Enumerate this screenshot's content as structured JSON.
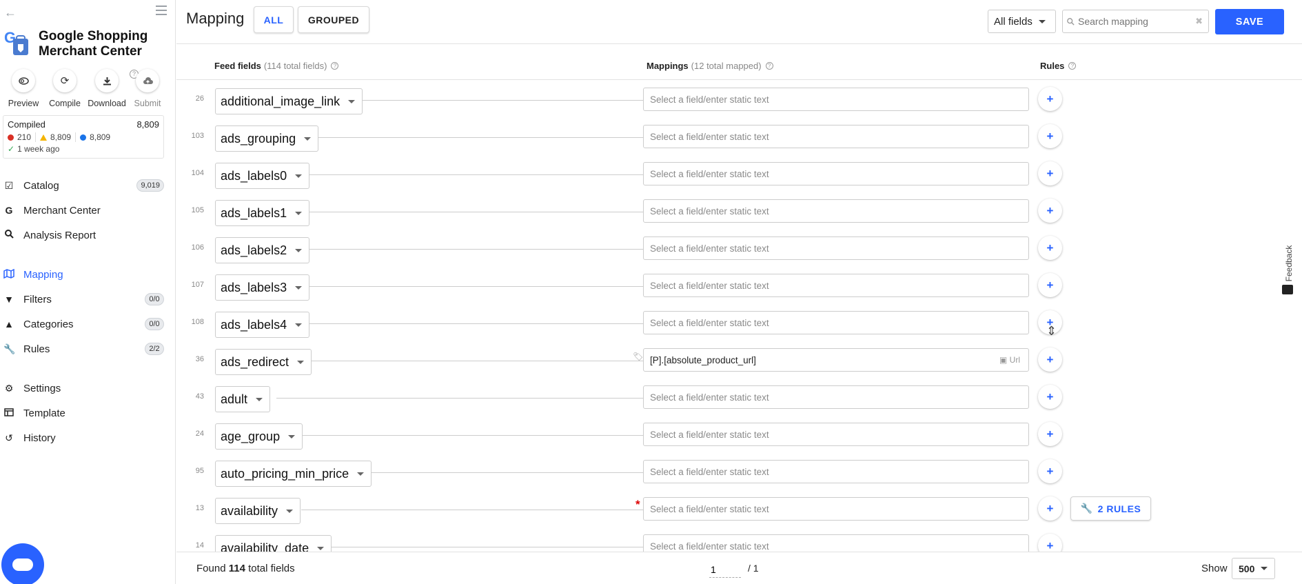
{
  "sidebar": {
    "brand_title": "Google Shopping Merchant Center",
    "actions": [
      {
        "label": "Preview",
        "icon": "eye-icon"
      },
      {
        "label": "Compile",
        "icon": "refresh-icon"
      },
      {
        "label": "Download",
        "icon": "download-icon"
      },
      {
        "label": "Submit",
        "icon": "cloud-upload-icon"
      }
    ],
    "compiled": {
      "title": "Compiled",
      "count": "8,809",
      "errors": "210",
      "warnings": "8,809",
      "info": "8,809",
      "time": "1 week ago"
    },
    "nav": [
      {
        "label": "Catalog",
        "badge": "9,019",
        "icon": "checkbox-icon"
      },
      {
        "label": "Merchant Center",
        "badge": "",
        "icon": "google-icon"
      },
      {
        "label": "Analysis Report",
        "badge": "",
        "icon": "search-icon"
      },
      {
        "label": "Mapping",
        "badge": "",
        "icon": "map-icon"
      },
      {
        "label": "Filters",
        "badge": "0/0",
        "icon": "filter-icon"
      },
      {
        "label": "Categories",
        "badge": "0/0",
        "icon": "tree-icon"
      },
      {
        "label": "Rules",
        "badge": "2/2",
        "icon": "wrench-icon"
      },
      {
        "label": "Settings",
        "badge": "",
        "icon": "gears-icon"
      },
      {
        "label": "Template",
        "badge": "",
        "icon": "table-icon"
      },
      {
        "label": "History",
        "badge": "",
        "icon": "history-icon"
      }
    ]
  },
  "header": {
    "title": "Mapping",
    "tab_all": "ALL",
    "tab_grouped": "GROUPED",
    "filter_label": "All fields",
    "search_placeholder": "Search mapping",
    "save_label": "SAVE"
  },
  "columns": {
    "feed_fields": "Feed fields",
    "feed_fields_sub": "(114 total fields)",
    "mappings": "Mappings",
    "mappings_sub": "(12 total mapped)",
    "rules": "Rules"
  },
  "rows": [
    {
      "num": "26",
      "field": "additional_image_link",
      "mapping": "",
      "placeholder": "Select a field/enter static text"
    },
    {
      "num": "103",
      "field": "ads_grouping",
      "mapping": "",
      "placeholder": "Select a field/enter static text"
    },
    {
      "num": "104",
      "field": "ads_labels0",
      "mapping": "",
      "placeholder": "Select a field/enter static text"
    },
    {
      "num": "105",
      "field": "ads_labels1",
      "mapping": "",
      "placeholder": "Select a field/enter static text"
    },
    {
      "num": "106",
      "field": "ads_labels2",
      "mapping": "",
      "placeholder": "Select a field/enter static text"
    },
    {
      "num": "107",
      "field": "ads_labels3",
      "mapping": "",
      "placeholder": "Select a field/enter static text"
    },
    {
      "num": "108",
      "field": "ads_labels4",
      "mapping": "",
      "placeholder": "Select a field/enter static text"
    },
    {
      "num": "36",
      "field": "ads_redirect",
      "mapping": "[P].[absolute_product_url]",
      "type": "Url",
      "placeholder": ""
    },
    {
      "num": "43",
      "field": "adult",
      "mapping": "",
      "placeholder": "Select a field/enter static text"
    },
    {
      "num": "24",
      "field": "age_group",
      "mapping": "",
      "placeholder": "Select a field/enter static text"
    },
    {
      "num": "95",
      "field": "auto_pricing_min_price",
      "mapping": "",
      "placeholder": "Select a field/enter static text"
    },
    {
      "num": "13",
      "field": "availability",
      "mapping": "",
      "placeholder": "Select a field/enter static text",
      "required": true,
      "rules": "2 RULES"
    },
    {
      "num": "14",
      "field": "availability_date",
      "mapping": "",
      "placeholder": "Select a field/enter static text"
    }
  ],
  "feedback": "Feedback",
  "footer": {
    "found_prefix": "Found",
    "found_count": "114",
    "found_suffix": "total fields",
    "page": "1",
    "page_total": "/ 1",
    "show_label": "Show",
    "show_value": "500"
  },
  "colors": {
    "accent": "#2962ff",
    "required": "#dd0000"
  }
}
